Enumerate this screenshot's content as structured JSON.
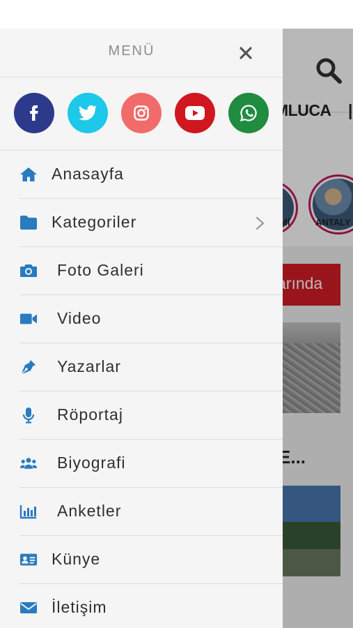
{
  "menu": {
    "title": "MENÜ",
    "close_icon": "close-icon",
    "socials": [
      {
        "name": "facebook",
        "icon": "facebook-icon",
        "color": "#2d3a8c"
      },
      {
        "name": "twitter",
        "icon": "twitter-icon",
        "color": "#1ec8e8"
      },
      {
        "name": "instagram",
        "icon": "instagram-icon",
        "color": "#f26b6b"
      },
      {
        "name": "youtube",
        "icon": "youtube-icon",
        "color": "#d0161f"
      },
      {
        "name": "whatsapp",
        "icon": "whatsapp-icon",
        "color": "#1f8c3f"
      }
    ],
    "items": [
      {
        "label": "Anasayfa",
        "icon": "home-icon"
      },
      {
        "label": "Kategoriler",
        "icon": "folder-icon",
        "has_submenu": true
      },
      {
        "label": "Foto Galeri",
        "icon": "camera-icon"
      },
      {
        "label": "Video",
        "icon": "video-icon"
      },
      {
        "label": "Yazarlar",
        "icon": "pen-icon"
      },
      {
        "label": "Röportaj",
        "icon": "microphone-icon"
      },
      {
        "label": "Biyografi",
        "icon": "users-icon"
      },
      {
        "label": "Anketler",
        "icon": "poll-chart-icon"
      },
      {
        "label": "Künye",
        "icon": "id-card-icon"
      },
      {
        "label": "İletişim",
        "icon": "envelope-icon"
      }
    ],
    "icon_color": "#2a7bbf"
  },
  "background": {
    "category_tab": "MLUCA",
    "stories": [
      {
        "label": "Mİ"
      },
      {
        "label": "ANTALY"
      }
    ],
    "banner_text": "arında",
    "headline_fragment": "E..."
  }
}
